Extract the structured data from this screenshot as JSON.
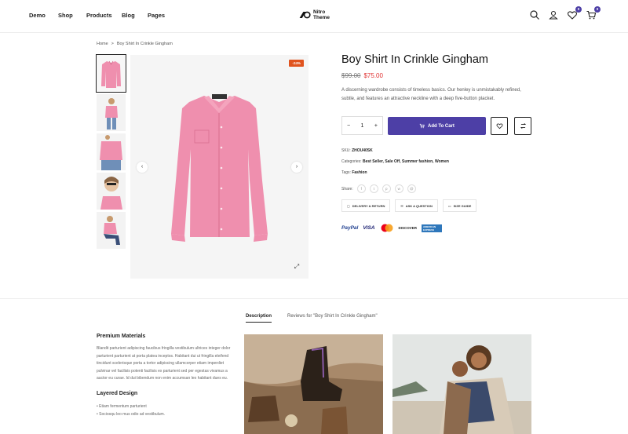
{
  "header": {
    "nav": [
      "Demo",
      "Shop",
      "Products",
      "Blog",
      "Pages"
    ],
    "logo_line1": "Nitro",
    "logo_line2": "Theme",
    "wishlist_count": "0",
    "cart_count": "0"
  },
  "breadcrumb": {
    "home": "Home",
    "separator": ">",
    "current": "Boy Shirt In Crinkle Gingham"
  },
  "product": {
    "sale_badge": "-24%",
    "title": "Boy Shirt In Crinkle Gingham",
    "old_price": "$99.00",
    "new_price": "$75.00",
    "description": "A discerning wardrobe consists of timeless basics. Our henley is unmistakably refined, subtle, and features an attractive neckline with a deep five-button placket.",
    "quantity": "1",
    "add_to_cart": "Add To Cart",
    "sku_label": "SKU:",
    "sku": "ZHOU40SK",
    "categories_label": "Categories:",
    "categories": "Best Seller, Sale Off, Summer fashion, Women",
    "tags_label": "Tags:",
    "tags": "Fashion",
    "share_label": "Share:",
    "links": {
      "delivery": "DELIVERY & RETURN",
      "question": "ASK A QUESTION",
      "size": "SIZE GUIDE"
    },
    "payments": {
      "paypal": "PayPal",
      "visa": "VISA",
      "discover": "DISCOVER",
      "amex": "AMERICAN EXPRESS"
    }
  },
  "tabs": {
    "description": "Description",
    "reviews": "Reviews for \"Boy Shirt In Crinkle Gingham\""
  },
  "content": {
    "h1": "Premium Materials",
    "p1": "Blandit parturient adipiscing faucibus fringilla vestibulum ultrices integer dolor parturient parturient at porta platea inceptos. Habitant dui ut fringilla eleifend tincidunt scelerisque porta a tortor adipiscing ullamcorper etiam imperdiet pulvinar vel facilisis potenti facilisis ex parturient sed per egestas vivamus a auctor eu curae. Id dui bibendum non enim accumsan leo habitant dues eu.",
    "h2": "Layered Design",
    "list": [
      "Etiam fermentum parturient",
      "Sociosqu leo mus odio ad vestibulum."
    ]
  },
  "colors": {
    "accent": "#4d3fa6",
    "sale": "#e0531e",
    "price": "#e03131",
    "shirt": "#ef8fae"
  }
}
